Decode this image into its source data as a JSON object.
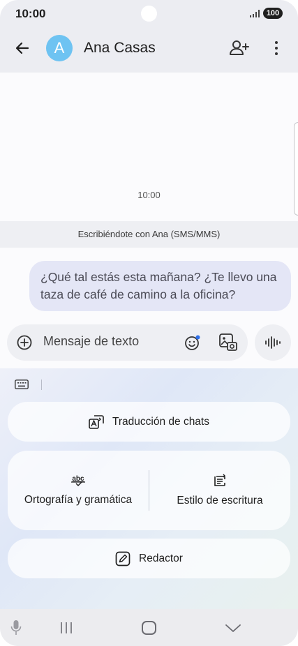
{
  "status_bar": {
    "time": "10:00",
    "battery": "100"
  },
  "header": {
    "contact_initial": "A",
    "contact_name": "Ana Casas"
  },
  "conversation": {
    "timestamp": "10:00",
    "banner": "Escribiéndote con Ana (SMS/MMS)",
    "messages": [
      {
        "text": "¿Qué tal estás esta mañana? ¿Te llevo una taza de café de camino a la oficina?"
      }
    ]
  },
  "composer": {
    "placeholder": "Mensaje de texto"
  },
  "ai_tools": {
    "translate_label": "Traducción de chats",
    "spelling_label": "Ortografía y gramática",
    "spelling_icon_text": "abc",
    "style_label": "Estilo de escritura",
    "composer_label": "Redactor"
  },
  "colors": {
    "avatar": "#6ec3f2",
    "bubble": "#e4e6f6",
    "header_bg": "#ecedf2"
  },
  "icons": [
    "back-arrow-icon",
    "add-contact-icon",
    "more-options-icon",
    "plus-circle-icon",
    "emoji-icon",
    "gallery-icon",
    "voice-icon",
    "keyboard-icon",
    "translate-icon",
    "spellcheck-icon",
    "writing-style-icon",
    "edit-icon",
    "mic-icon"
  ]
}
